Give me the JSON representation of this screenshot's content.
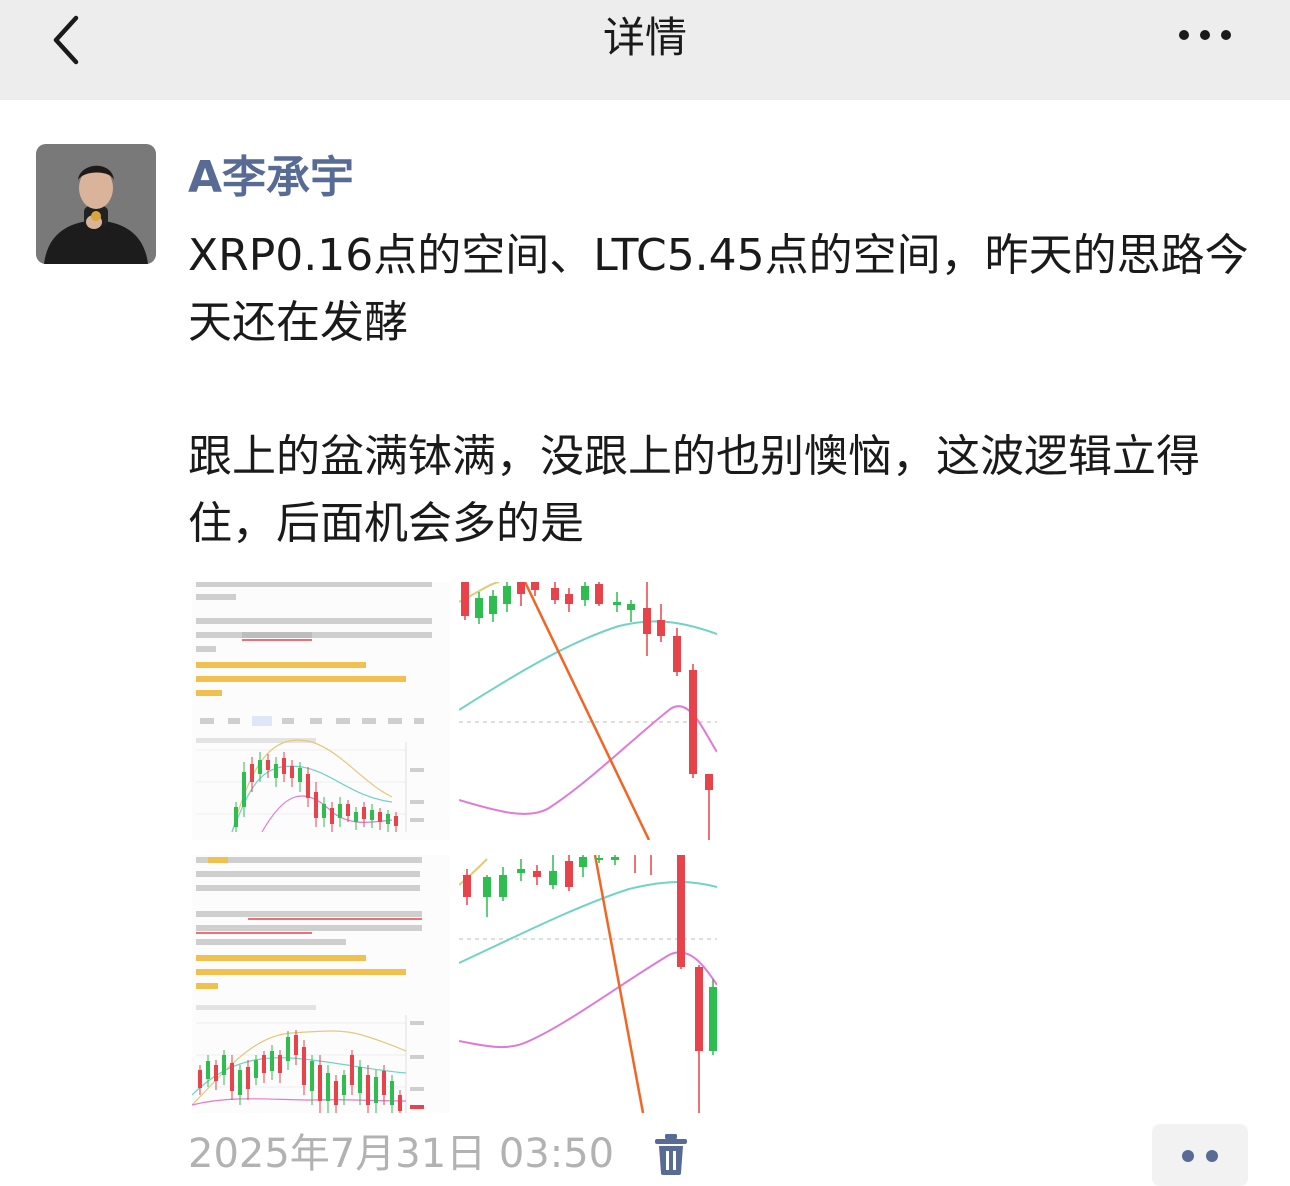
{
  "header": {
    "title": "详情",
    "back_icon": "chevron-left-icon",
    "more_icon": "more-horizontal-icon"
  },
  "post": {
    "author": "A李承宇",
    "text": "XRP0.16点的空间、LTC5.45点的空间，昨天的思路今天还在发酵\n\n跟上的盆满钵满，没跟上的也别懊恼，这波逻辑立得住，后面机会多的是",
    "images": [
      {
        "name": "xrp-analysis-screenshot"
      },
      {
        "name": "xrp-candlestick-closeup"
      },
      {
        "name": "ltc-analysis-screenshot"
      },
      {
        "name": "ltc-candlestick-closeup"
      }
    ],
    "timestamp": "2025年7月31日 03:50",
    "delete_icon": "trash-icon",
    "action_icon": "more-dots-icon"
  },
  "colors": {
    "header_bg": "#ededed",
    "author_name": "#576b95",
    "timestamp": "#b2b2b2",
    "candle_up": "#2ebd4f",
    "candle_down": "#e8424b",
    "trend_line": "#f26522",
    "upper_band": "#6fd3c6",
    "lower_band": "#e07ad8"
  }
}
